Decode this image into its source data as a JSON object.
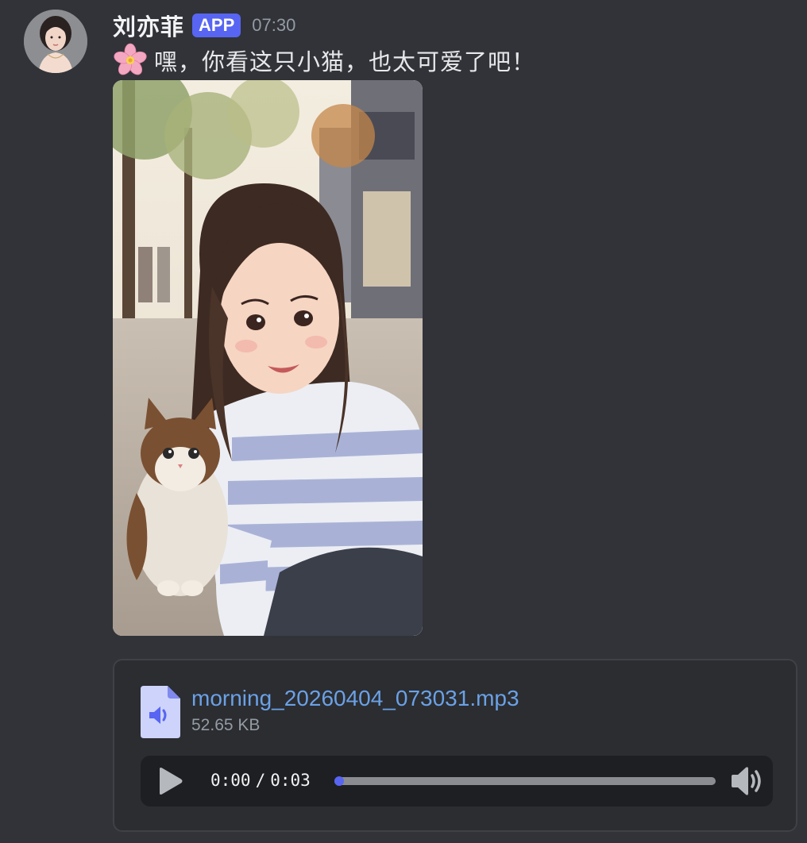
{
  "message": {
    "author": "刘亦菲",
    "badge": "APP",
    "timestamp": "07:30",
    "emoji_icon": "cherry-blossom-icon",
    "text": "嘿，你看这只小猫，也太可爱了吧！"
  },
  "attachment_image": {
    "subject_icon": "illustration-girl-with-cat"
  },
  "audio_attachment": {
    "file_name": "morning_20260404_073031.mp3",
    "file_size": "52.65 KB",
    "current_time": "0:00",
    "separator": "/",
    "duration": "0:03",
    "progress_fraction": 0.0
  },
  "colors": {
    "background": "#313338",
    "accent": "#5865f2",
    "link": "#6ba1e6",
    "muted": "#949ba4"
  }
}
